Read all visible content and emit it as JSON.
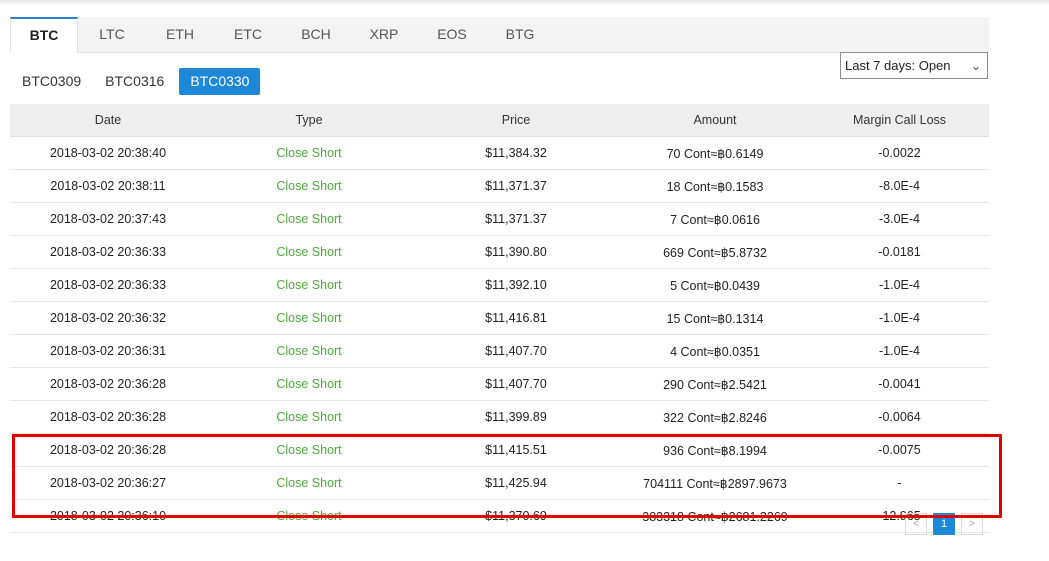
{
  "coin_tabs": [
    "BTC",
    "LTC",
    "ETH",
    "ETC",
    "BCH",
    "XRP",
    "EOS",
    "BTG"
  ],
  "active_coin": "BTC",
  "contract_tabs": [
    "BTC0309",
    "BTC0316",
    "BTC0330"
  ],
  "active_contract": "BTC0330",
  "range_select": {
    "value": "Last 7 days: Open"
  },
  "table": {
    "headers": [
      "Date",
      "Type",
      "Price",
      "Amount",
      "Margin Call Loss"
    ],
    "rows": [
      [
        "2018-03-02 20:38:40",
        "Close Short",
        "$11,384.32",
        "70 Cont≈฿0.6149",
        "-0.0022"
      ],
      [
        "2018-03-02 20:38:11",
        "Close Short",
        "$11,371.37",
        "18 Cont≈฿0.1583",
        "-8.0E-4"
      ],
      [
        "2018-03-02 20:37:43",
        "Close Short",
        "$11,371.37",
        "7 Cont≈฿0.0616",
        "-3.0E-4"
      ],
      [
        "2018-03-02 20:36:33",
        "Close Short",
        "$11,390.80",
        "669 Cont≈฿5.8732",
        "-0.0181"
      ],
      [
        "2018-03-02 20:36:33",
        "Close Short",
        "$11,392.10",
        "5 Cont≈฿0.0439",
        "-1.0E-4"
      ],
      [
        "2018-03-02 20:36:32",
        "Close Short",
        "$11,416.81",
        "15 Cont≈฿0.1314",
        "-1.0E-4"
      ],
      [
        "2018-03-02 20:36:31",
        "Close Short",
        "$11,407.70",
        "4 Cont≈฿0.0351",
        "-1.0E-4"
      ],
      [
        "2018-03-02 20:36:28",
        "Close Short",
        "$11,407.70",
        "290 Cont≈฿2.5421",
        "-0.0041"
      ],
      [
        "2018-03-02 20:36:28",
        "Close Short",
        "$11,399.89",
        "322 Cont≈฿2.8246",
        "-0.0064"
      ],
      [
        "2018-03-02 20:36:28",
        "Close Short",
        "$11,415.51",
        "936 Cont≈฿8.1994",
        "-0.0075"
      ],
      [
        "2018-03-02 20:36:27",
        "Close Short",
        "$11,425.94",
        "704111 Cont≈฿2897.9673",
        "-"
      ],
      [
        "2018-03-02 20:36:10",
        "Close Short",
        "$11,370.69",
        "383318 Cont≈฿2681.2269",
        "-12.965"
      ]
    ]
  },
  "pagination": {
    "prev": "<",
    "current": "1",
    "next": ">"
  },
  "colors": {
    "accent": "#1e88d8",
    "close_short": "#4fa83d",
    "highlight": "#e00000"
  },
  "icons": {
    "select_chevron": "chevron-down-icon"
  }
}
